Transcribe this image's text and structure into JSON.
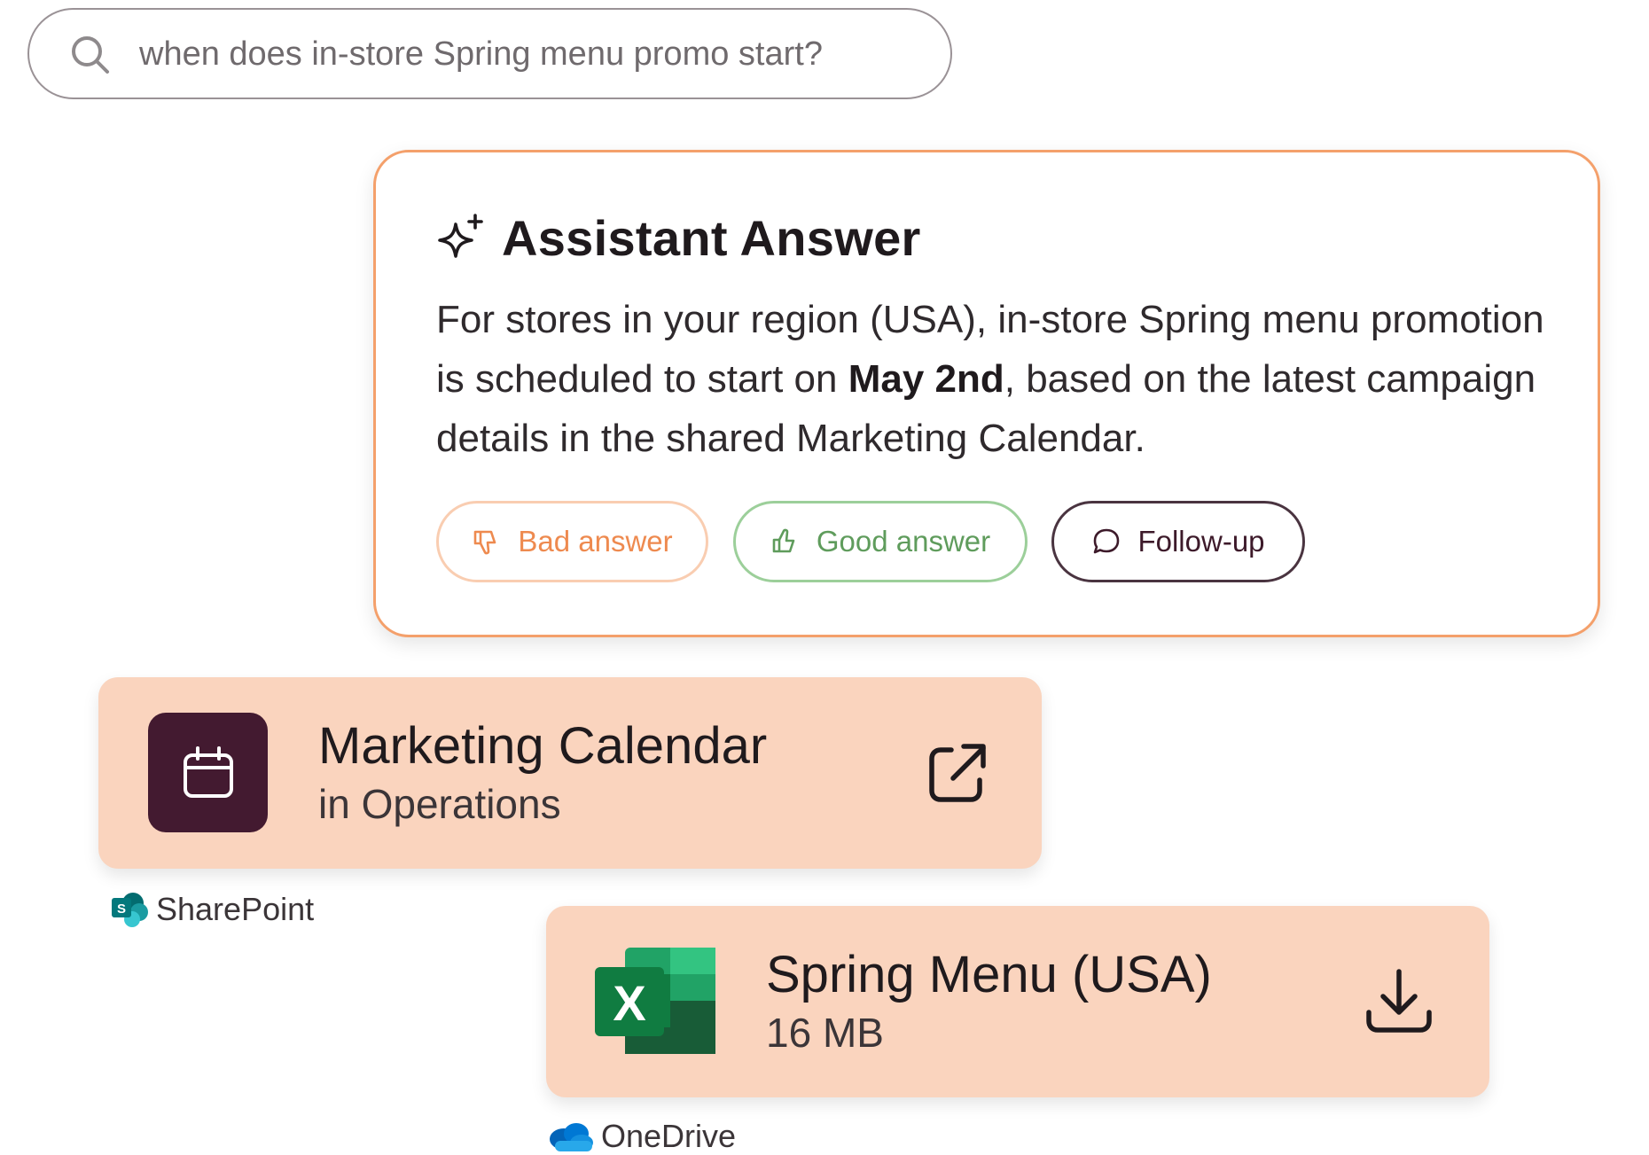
{
  "search": {
    "query": "when does in-store Spring menu promo start?"
  },
  "answer": {
    "title": "Assistant Answer",
    "text_before": "For stores in your region (USA), in-store Spring menu promotion is scheduled to start on ",
    "text_bold": "May 2nd",
    "text_after": ", based on the latest campaign details in the shared Marketing Calendar.",
    "buttons": {
      "bad": "Bad answer",
      "good": "Good answer",
      "followup": "Follow-up"
    },
    "colors": {
      "border": "#f4a06b",
      "bad": "#ee8a4f",
      "good": "#5f9c5c",
      "followup": "#3d1a2a"
    }
  },
  "results": [
    {
      "name": "Marketing Calendar",
      "subtitle": "in Operations",
      "source": "SharePoint",
      "icon": "calendar-icon",
      "action_icon": "open-external-icon"
    },
    {
      "name": "Spring Menu (USA)",
      "subtitle": "16 MB",
      "source": "OneDrive",
      "icon": "excel-icon",
      "action_icon": "download-icon"
    }
  ],
  "colors": {
    "card_bg": "#fad4be",
    "calendar_tile": "#431a30"
  }
}
